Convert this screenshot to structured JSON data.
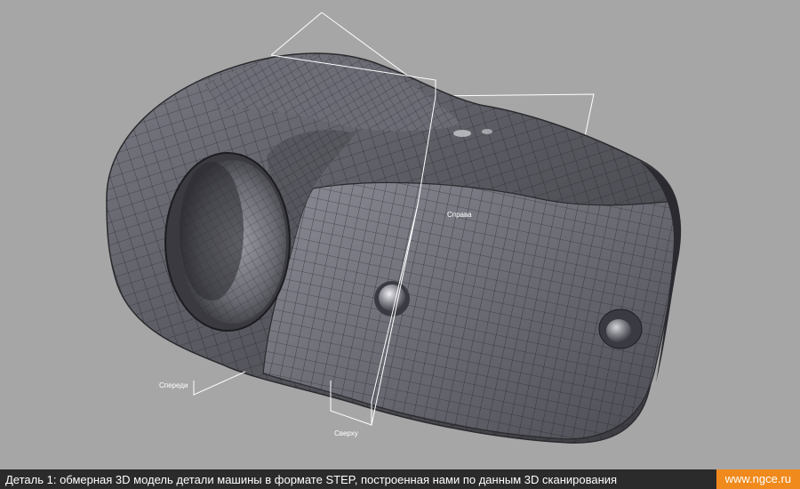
{
  "viewport": {
    "plane_labels": {
      "right": "Справа",
      "front": "Спереди",
      "top": "Сверху"
    }
  },
  "caption": {
    "text": "Деталь 1: обмерная 3D модель детали машины в формате STEP, построенная нами по данным 3D сканирования",
    "site": "www.ngce.ru"
  },
  "colors": {
    "caption_bar": "#2b2b2b",
    "site_badge": "#f08a1c",
    "viewport_bg": "#a6a6a6",
    "model_surface": "#5c5c64"
  }
}
